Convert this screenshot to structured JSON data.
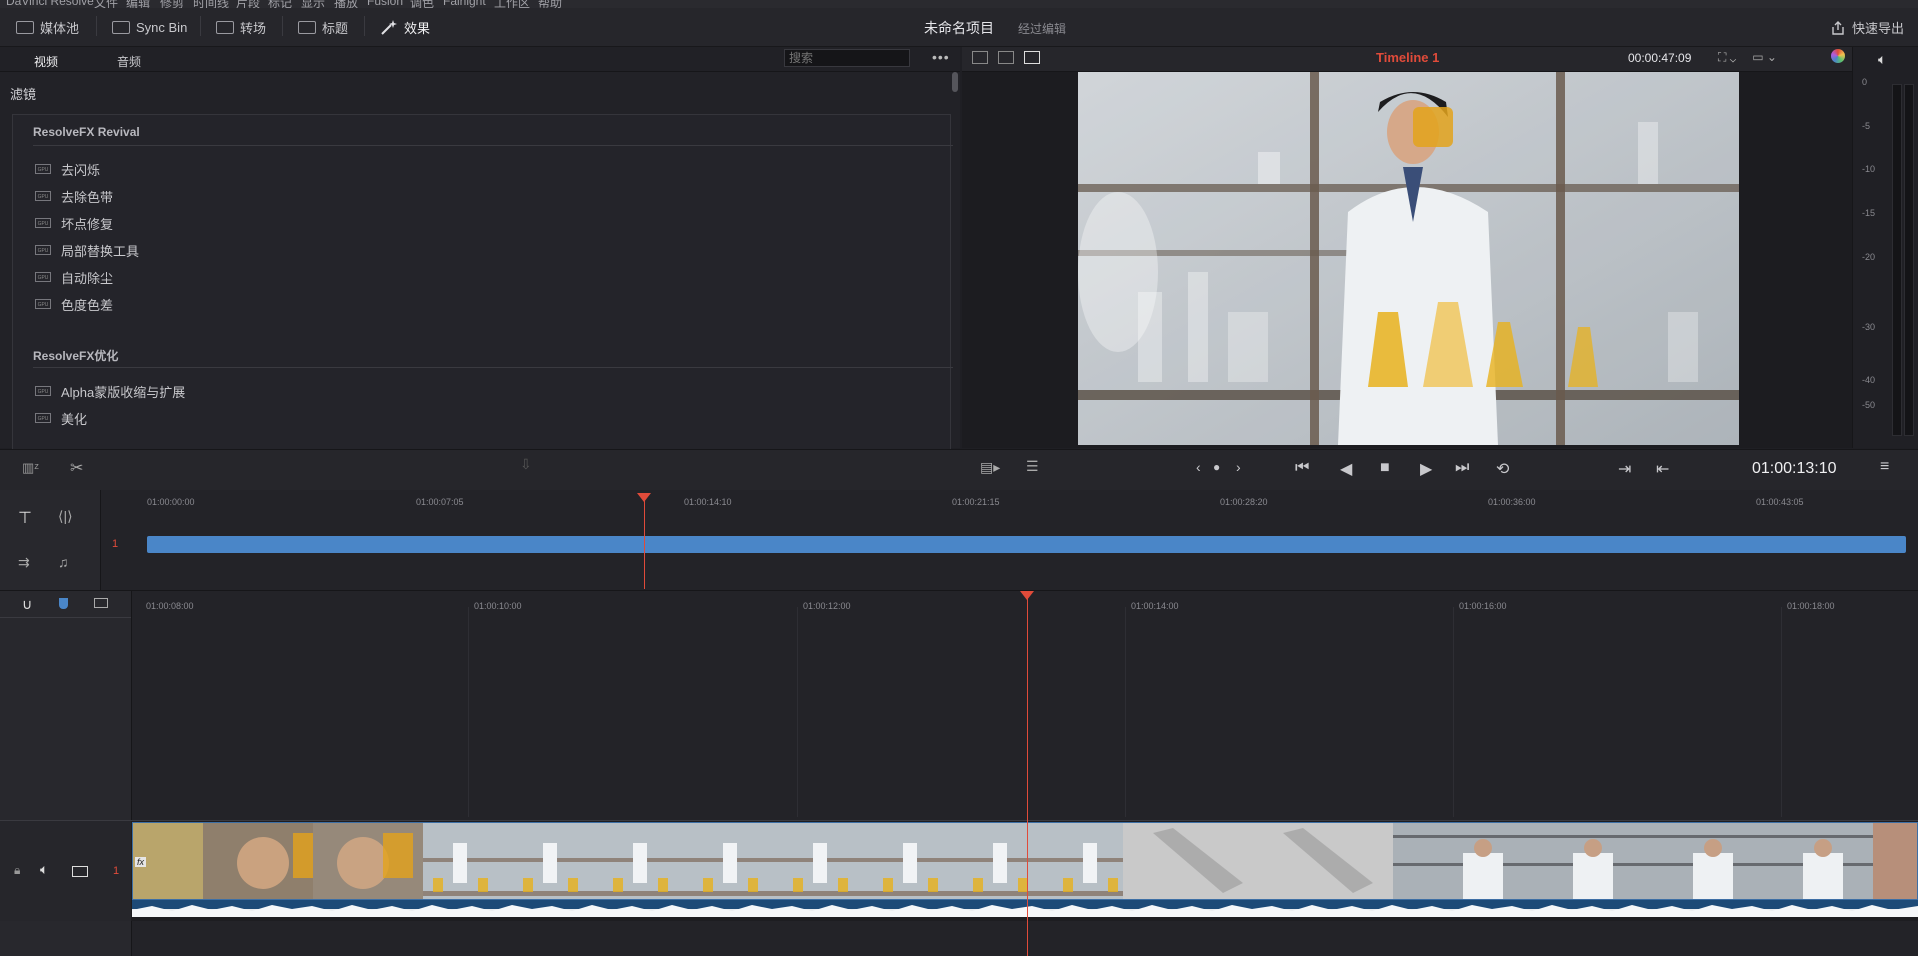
{
  "menubar": {
    "items": [
      "DaVinci Resolve",
      "文件",
      "编辑",
      "修剪",
      "时间线",
      "片段",
      "标记",
      "显示",
      "播放",
      "Fusion",
      "调色",
      "Fairlight",
      "工作区",
      "帮助"
    ]
  },
  "toolbar": {
    "media_pool": "媒体池",
    "sync_bin": "Sync Bin",
    "transitions": "转场",
    "titles": "标题",
    "effects": "效果",
    "project_title": "未命名项目",
    "project_status": "经过编辑",
    "quick_export": "快速导出"
  },
  "effects_panel": {
    "tab_video": "视频",
    "tab_audio": "音频",
    "search_placeholder": "搜索",
    "heading": "滤镜",
    "groups": [
      {
        "name": "ResolveFX Revival",
        "items": [
          "去闪烁",
          "去除色带",
          "坏点修复",
          "局部替换工具",
          "自动除尘",
          "色度色差"
        ]
      },
      {
        "name": "ResolveFX优化",
        "items": [
          "Alpha蒙版收缩与扩展",
          "美化"
        ]
      }
    ]
  },
  "viewer": {
    "timeline_name": "Timeline 1",
    "duration_timecode": "00:00:47:09",
    "current_timecode": "01:00:13:10"
  },
  "meter": {
    "ticks": [
      "0",
      "-5",
      "-10",
      "-15",
      "-20",
      "-30",
      "-40",
      "-50"
    ]
  },
  "mini_timeline": {
    "track_number": "1",
    "ruler": [
      "01:00:00:00",
      "01:00:07:05",
      "01:00:14:10",
      "01:00:21:15",
      "01:00:28:20",
      "01:00:36:00",
      "01:00:43:05"
    ]
  },
  "main_timeline": {
    "track_number": "1",
    "ruler": [
      "01:00:08:00",
      "01:00:10:00",
      "01:00:12:00",
      "01:00:14:00",
      "01:00:16:00",
      "01:00:18:00"
    ],
    "fx_badge": "fx"
  },
  "colors": {
    "accent_red": "#e04b3a",
    "clip_blue": "#4a86c8",
    "panel_bg": "#222227"
  }
}
